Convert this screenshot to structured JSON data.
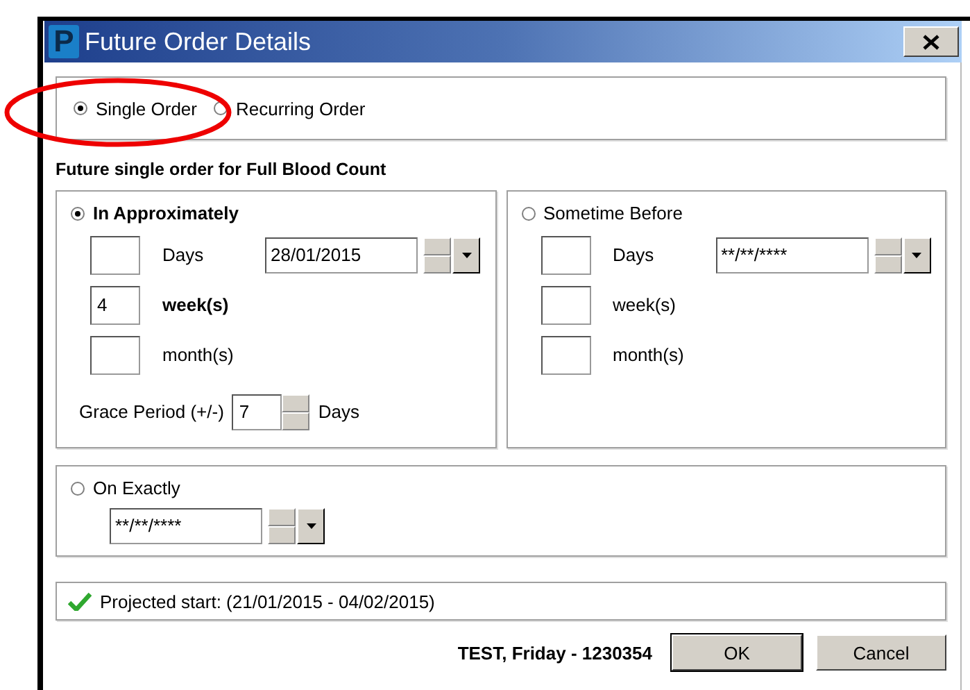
{
  "window": {
    "title": "Future Order Details",
    "logo": "P"
  },
  "order_type": [
    {
      "label": "Single Order",
      "selected": true
    },
    {
      "label": "Recurring Order",
      "selected": false
    }
  ],
  "heading": "Future single order for Full Blood Count",
  "in_approximately": {
    "label": "In Approximately",
    "selected": true,
    "rows": [
      {
        "unit": "Days",
        "bold": false
      },
      {
        "value": "4",
        "unit": "week(s)",
        "bold": true
      },
      {
        "unit": "month(s)",
        "bold": false
      }
    ],
    "date": "28/01/2015",
    "grace_label": "Grace Period (+/-)",
    "grace_value": "7",
    "grace_unit": "Days"
  },
  "sometime_before": {
    "label": "Sometime Before",
    "selected": false,
    "rows": [
      {
        "unit": "Days",
        "bold": false
      },
      {
        "unit": "week(s)",
        "bold": false
      },
      {
        "unit": "month(s)",
        "bold": false
      }
    ],
    "date": "**/**/****"
  },
  "on_exactly": {
    "label": "On Exactly",
    "selected": false,
    "date": "**/**/****"
  },
  "projected_start": "Projected start: (21/01/2015 - 04/02/2015)",
  "patient": "TEST, Friday - 1230354",
  "buttons": [
    "OK",
    "Cancel"
  ]
}
